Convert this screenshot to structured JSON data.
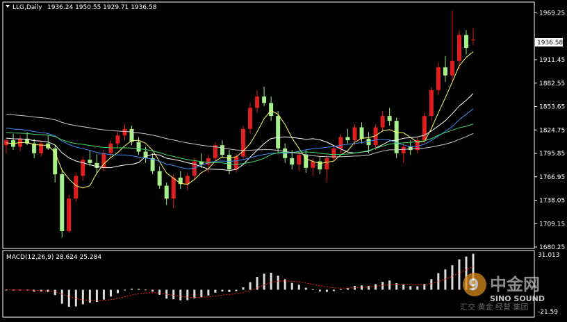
{
  "header": {
    "symbol_label": "LLG,Daily",
    "ohlc": "1936.24 1950.55 1929.71 1936.58"
  },
  "price_axis": {
    "ticks": [
      "1969.25",
      "1911.45",
      "1882.55",
      "1853.65",
      "1824.75",
      "1795.85",
      "1766.95",
      "1738.05",
      "1709.15",
      "1680.25"
    ],
    "current_price": "1936.58"
  },
  "macd_panel": {
    "label": "MACD(12,26,9) 28.624 25.284",
    "ticks": [
      "31.013",
      "-21.59"
    ]
  },
  "watermark": {
    "brand_cn": "中金网",
    "brand_en": "SINO SOUND",
    "slogan": "汇交 黄金 经营 集团"
  },
  "colors": {
    "background": "#000000",
    "up": "#dd1f1f",
    "down": "#a6ef8a",
    "ma_fast": "#ffff66",
    "ma_mid": "#ffffff",
    "ma_blue": "#3f8cf6",
    "ma_green": "#44dd66",
    "ma_slow": "#cccccc",
    "macd_hist": "#dddddd",
    "macd_signal": "#ff2020",
    "axis": "#ffffff"
  },
  "chart_data": {
    "type": "candlestick",
    "symbol": "LLG",
    "timeframe": "Daily",
    "ylim": [
      1680.25,
      1980
    ],
    "last": {
      "open": 1936.24,
      "high": 1950.55,
      "low": 1929.71,
      "close": 1936.58
    },
    "candles": [
      [
        1806,
        1815,
        1796,
        1812
      ],
      [
        1812,
        1820,
        1800,
        1804
      ],
      [
        1804,
        1818,
        1798,
        1814
      ],
      [
        1814,
        1822,
        1806,
        1808
      ],
      [
        1808,
        1814,
        1790,
        1796
      ],
      [
        1796,
        1812,
        1792,
        1808
      ],
      [
        1808,
        1818,
        1800,
        1802
      ],
      [
        1802,
        1806,
        1760,
        1770
      ],
      [
        1770,
        1776,
        1692,
        1700
      ],
      [
        1700,
        1745,
        1698,
        1740
      ],
      [
        1740,
        1772,
        1736,
        1768
      ],
      [
        1768,
        1792,
        1762,
        1788
      ],
      [
        1788,
        1800,
        1780,
        1784
      ],
      [
        1784,
        1795,
        1772,
        1778
      ],
      [
        1778,
        1800,
        1774,
        1796
      ],
      [
        1796,
        1812,
        1790,
        1808
      ],
      [
        1808,
        1822,
        1802,
        1818
      ],
      [
        1818,
        1832,
        1812,
        1826
      ],
      [
        1826,
        1830,
        1806,
        1810
      ],
      [
        1810,
        1816,
        1794,
        1798
      ],
      [
        1798,
        1804,
        1784,
        1790
      ],
      [
        1790,
        1796,
        1770,
        1774
      ],
      [
        1774,
        1780,
        1752,
        1756
      ],
      [
        1756,
        1760,
        1732,
        1740
      ],
      [
        1740,
        1770,
        1728,
        1766
      ],
      [
        1766,
        1774,
        1752,
        1758
      ],
      [
        1758,
        1772,
        1750,
        1768
      ],
      [
        1768,
        1790,
        1764,
        1786
      ],
      [
        1786,
        1796,
        1778,
        1782
      ],
      [
        1782,
        1794,
        1772,
        1790
      ],
      [
        1790,
        1810,
        1786,
        1806
      ],
      [
        1806,
        1812,
        1790,
        1794
      ],
      [
        1794,
        1800,
        1770,
        1776
      ],
      [
        1776,
        1796,
        1772,
        1792
      ],
      [
        1792,
        1830,
        1788,
        1826
      ],
      [
        1826,
        1858,
        1820,
        1852
      ],
      [
        1852,
        1874,
        1846,
        1866
      ],
      [
        1866,
        1878,
        1854,
        1858
      ],
      [
        1858,
        1866,
        1836,
        1842
      ],
      [
        1842,
        1848,
        1796,
        1802
      ],
      [
        1802,
        1808,
        1784,
        1790
      ],
      [
        1790,
        1800,
        1776,
        1782
      ],
      [
        1782,
        1798,
        1774,
        1794
      ],
      [
        1794,
        1800,
        1772,
        1778
      ],
      [
        1778,
        1790,
        1768,
        1786
      ],
      [
        1786,
        1792,
        1770,
        1776
      ],
      [
        1776,
        1794,
        1760,
        1790
      ],
      [
        1790,
        1806,
        1786,
        1802
      ],
      [
        1802,
        1820,
        1796,
        1816
      ],
      [
        1816,
        1826,
        1808,
        1812
      ],
      [
        1812,
        1832,
        1806,
        1828
      ],
      [
        1828,
        1834,
        1808,
        1814
      ],
      [
        1814,
        1822,
        1796,
        1806
      ],
      [
        1806,
        1832,
        1800,
        1828
      ],
      [
        1828,
        1848,
        1822,
        1842
      ],
      [
        1842,
        1852,
        1830,
        1836
      ],
      [
        1836,
        1840,
        1790,
        1796
      ],
      [
        1796,
        1808,
        1784,
        1804
      ],
      [
        1804,
        1812,
        1794,
        1800
      ],
      [
        1800,
        1816,
        1796,
        1812
      ],
      [
        1812,
        1846,
        1808,
        1842
      ],
      [
        1842,
        1878,
        1836,
        1874
      ],
      [
        1874,
        1908,
        1868,
        1902
      ],
      [
        1902,
        1916,
        1884,
        1892
      ],
      [
        1892,
        1972,
        1886,
        1910
      ],
      [
        1910,
        1948,
        1900,
        1942
      ],
      [
        1942,
        1948,
        1918,
        1926
      ],
      [
        1936.24,
        1950.55,
        1929.71,
        1936.58
      ]
    ],
    "macd": {
      "label": "MACD(12,26,9)",
      "value": 28.624,
      "signal": 25.284,
      "ylim": [
        -21.59,
        31.013
      ]
    }
  }
}
